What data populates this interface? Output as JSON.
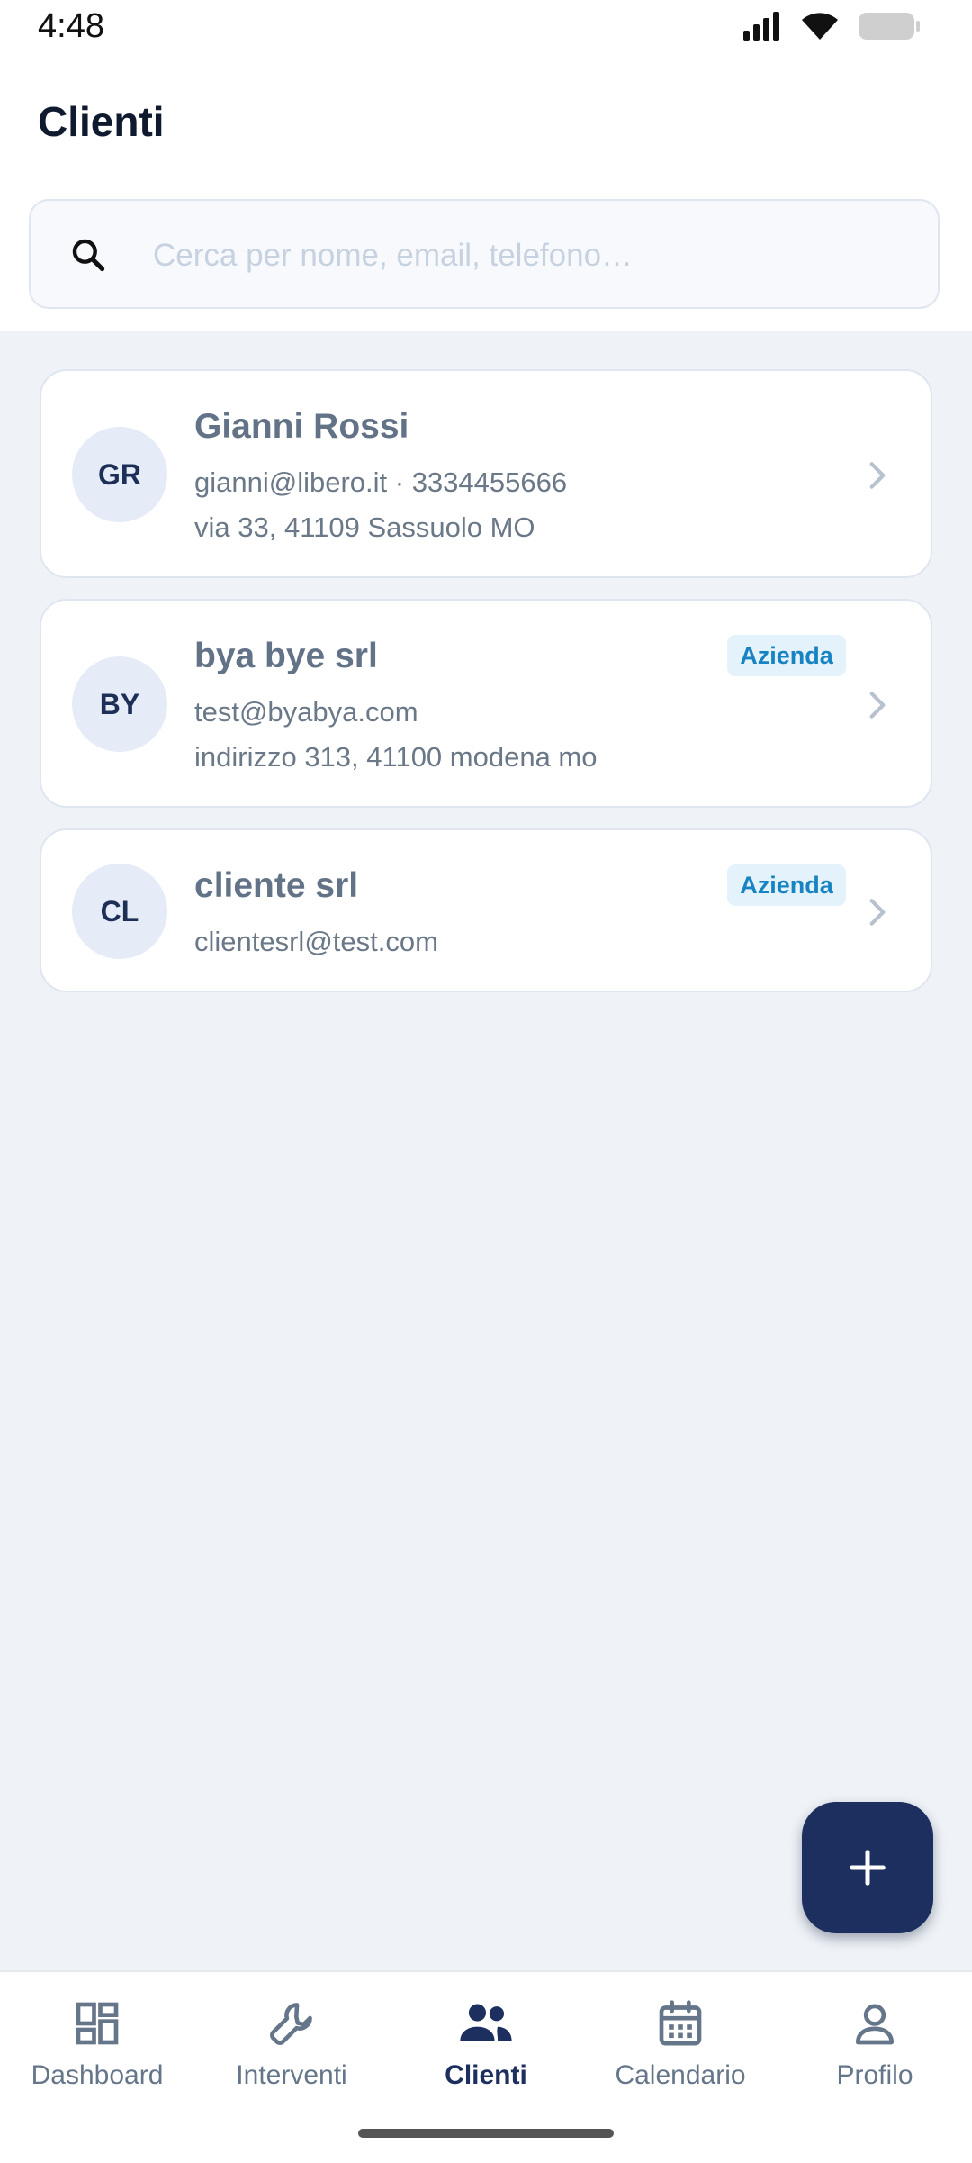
{
  "status_bar": {
    "time": "4:48"
  },
  "page": {
    "title": "Clienti"
  },
  "search": {
    "placeholder": "Cerca per nome, email, telefono…"
  },
  "clients": [
    {
      "initials": "GR",
      "name": "Gianni Rossi",
      "contact": "gianni@libero.it · 3334455666",
      "address": "via 33, 41109 Sassuolo MO",
      "badge": ""
    },
    {
      "initials": "BY",
      "name": "bya bye srl",
      "contact": "test@byabya.com",
      "address": "indirizzo 313, 41100 modena mo",
      "badge": "Azienda"
    },
    {
      "initials": "CL",
      "name": "cliente srl",
      "contact": "clientesrl@test.com",
      "address": "",
      "badge": "Azienda"
    }
  ],
  "fab": {
    "icon": "plus-icon"
  },
  "bottom_nav": {
    "items": [
      {
        "label": "Dashboard",
        "icon": "dashboard-icon",
        "active": false
      },
      {
        "label": "Interventi",
        "icon": "wrench-icon",
        "active": false
      },
      {
        "label": "Clienti",
        "icon": "people-icon",
        "active": true
      },
      {
        "label": "Calendario",
        "icon": "calendar-icon",
        "active": false
      },
      {
        "label": "Profilo",
        "icon": "person-icon",
        "active": false
      }
    ]
  },
  "colors": {
    "primary": "#1d2f5e",
    "badge_text": "#1783c2",
    "badge_bg": "#e4f2fb",
    "background": "#eff3f8"
  }
}
